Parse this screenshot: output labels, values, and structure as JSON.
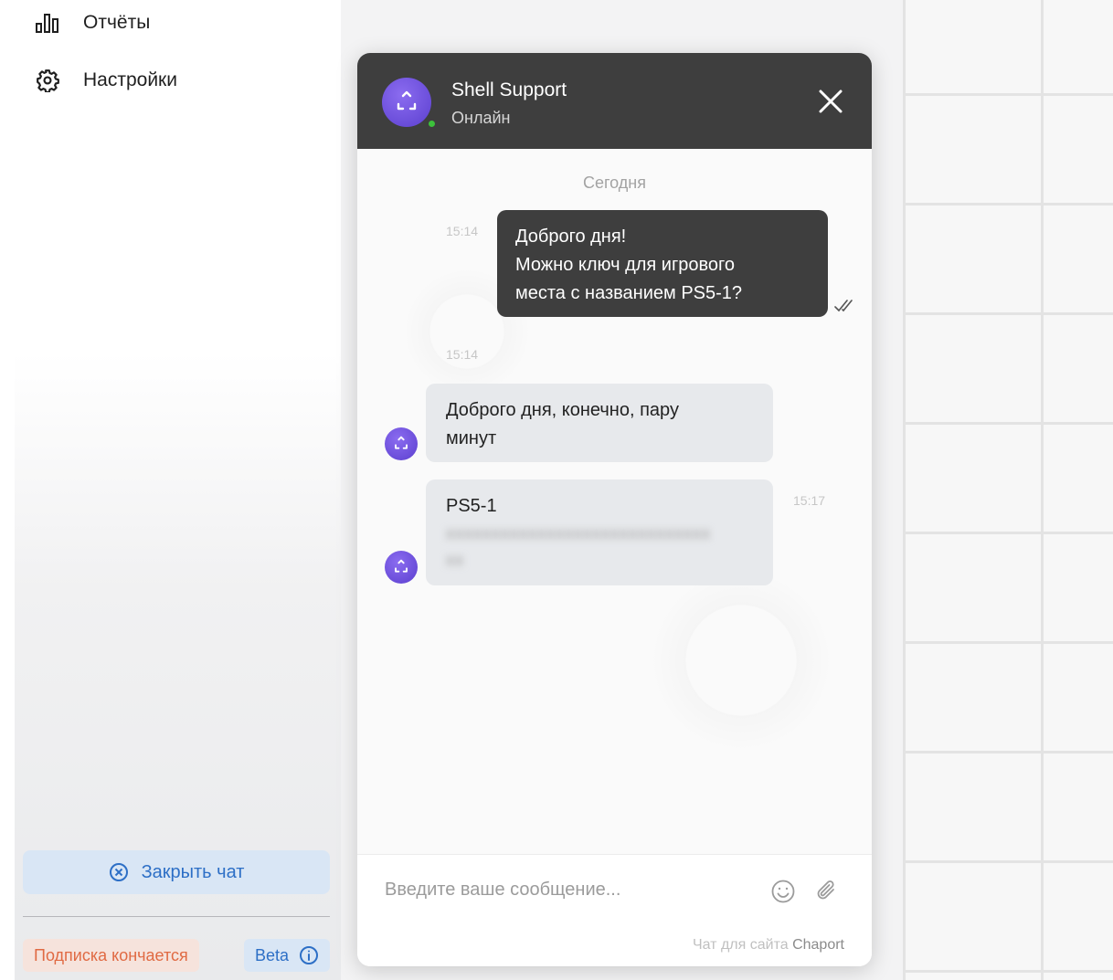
{
  "sidebar": {
    "items": [
      {
        "label": "Отчёты",
        "icon": "bar-chart-icon"
      },
      {
        "label": "Настройки",
        "icon": "gear-icon"
      }
    ],
    "close_chat_label": "Закрыть чат",
    "subscription_badge": "Подписка кончается",
    "beta_label": "Beta"
  },
  "chat": {
    "header": {
      "title": "Shell Support",
      "status": "Онлайн"
    },
    "date_separator": "Сегодня",
    "messages": [
      {
        "direction": "out",
        "time": "15:14",
        "lines": [
          "Доброго дня!",
          "Можно ключ для игрового",
          "места с названием PS5-1?"
        ],
        "read": true
      },
      {
        "direction": "in",
        "time": "15:14",
        "lines": [
          "Доброго дня, конечно, пару",
          "минут"
        ]
      },
      {
        "direction": "in",
        "time": "15:17",
        "lines": [
          "PS5-1"
        ],
        "redacted": true
      }
    ],
    "input": {
      "placeholder": "Введите ваше сообщение..."
    },
    "footer": {
      "powered_prefix": "Чат для сайта",
      "powered_brand": "Chaport"
    }
  },
  "colors": {
    "accent": "#2d6fc6",
    "header_bg": "#3e3e3e",
    "avatar": "#6a4fe0",
    "online": "#3cc13b",
    "warning": "#e06a43"
  }
}
